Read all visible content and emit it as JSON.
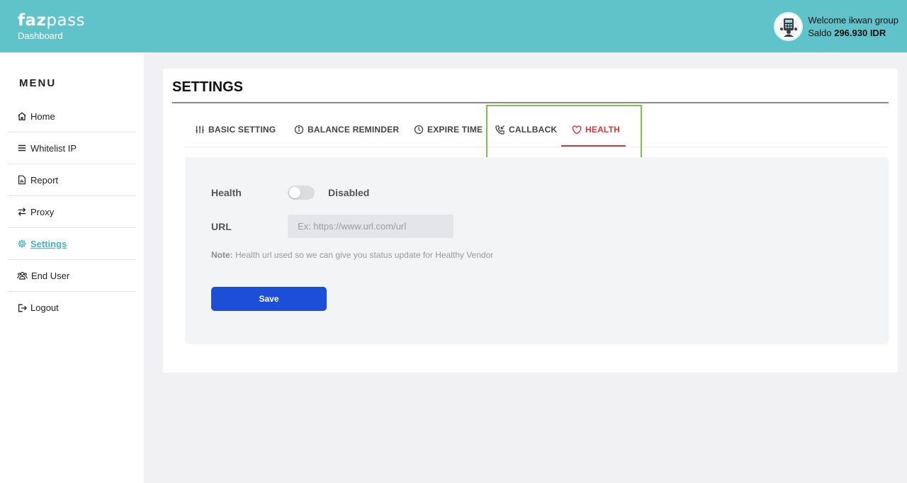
{
  "brand": {
    "name_bold": "faz",
    "name_light": "pass",
    "subtitle": "Dashboard"
  },
  "user": {
    "welcome": "Welcome ikwan group",
    "saldo_label": "Saldo",
    "saldo_value": "296.930 IDR"
  },
  "sidebar": {
    "title": "MENU",
    "items": [
      {
        "label": "Home",
        "icon": "home-icon"
      },
      {
        "label": "Whitelist IP",
        "icon": "list-icon"
      },
      {
        "label": "Report",
        "icon": "report-icon"
      },
      {
        "label": "Proxy",
        "icon": "swap-arrows-icon"
      },
      {
        "label": "Settings",
        "icon": "gear-icon",
        "active": true
      },
      {
        "label": "End User",
        "icon": "users-icon"
      },
      {
        "label": "Logout",
        "icon": "logout-icon"
      }
    ]
  },
  "settings": {
    "title": "SETTINGS",
    "tabs": [
      {
        "label": "BASIC SETTING",
        "icon": "sliders-icon"
      },
      {
        "label": "BALANCE REMINDER",
        "icon": "info-circle-icon"
      },
      {
        "label": "EXPIRE TIME",
        "icon": "clock-icon"
      },
      {
        "label": "CALLBACK",
        "icon": "phone-callback-icon"
      },
      {
        "label": "HEALTH",
        "icon": "heart-icon",
        "active": true
      }
    ],
    "health": {
      "label": "Health",
      "toggle_on": false,
      "toggle_state": "Disabled",
      "url_label": "URL",
      "url_value": "",
      "url_placeholder": "Ex: https://www.url.com/url",
      "note_label": "Note:",
      "note_text": "Health url used so we can give you status update for Healthy Vendor",
      "save_label": "Save"
    }
  },
  "colors": {
    "header": "#61c3ca",
    "active_nav": "#46b3bb",
    "active_tab": "#d8343c",
    "save_button": "#1d4ed8",
    "highlight_box": "#7cbf4a"
  }
}
